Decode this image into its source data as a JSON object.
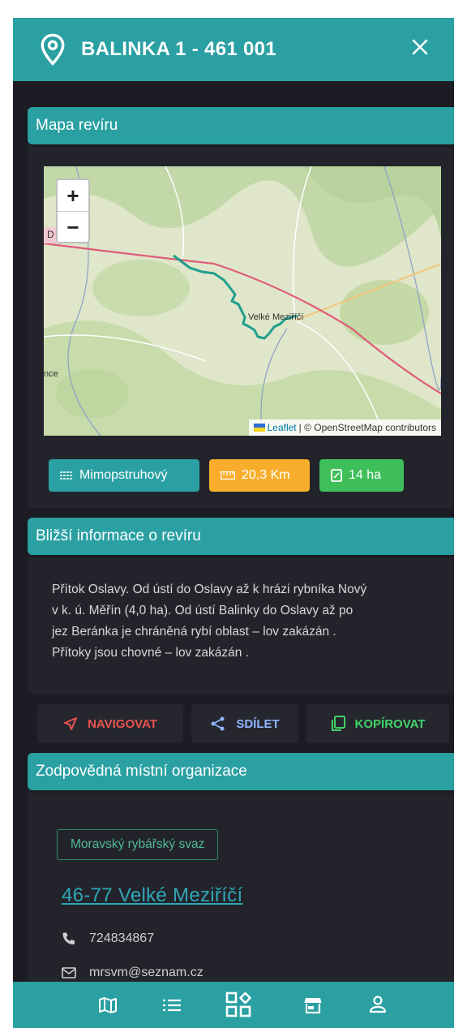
{
  "header": {
    "title": "BALINKA 1 - 461 001"
  },
  "map_card": {
    "title": "Mapa revíru",
    "zoom_in": "+",
    "zoom_out": "−",
    "town_label": "Velké Meziříčí",
    "edge_label_left": "D",
    "edge_label_side": "nce",
    "attribution_link": "Leaflet",
    "attribution_text": "| © OpenStreetMap contributors",
    "chips": [
      {
        "label": "Mimopstruhový",
        "icon": "waves-icon",
        "color": "#2aa0a3"
      },
      {
        "label": "20,3 Km",
        "icon": "ruler-icon",
        "color": "#f8ae2c"
      },
      {
        "label": "14 ha",
        "icon": "area-icon",
        "color": "#3fbf5a"
      }
    ]
  },
  "info_card": {
    "title": "Bližší informace o revíru",
    "lines": [
      "Přítok Oslavy. Od ústí do Oslavy až k hrázi rybníka Nový",
      "v k. ú. Měřín (4,0 ha). Od ústí Balinky do Oslavy až po",
      "jez Beránka je chráněná rybí oblast – lov zakázán .",
      "Přítoky jsou chovné – lov zakázán ."
    ]
  },
  "actions": {
    "navigate": "NAVIGOVAT",
    "share": "SDÍLET",
    "copy": "KOPÍROVAT"
  },
  "org_card": {
    "title": "Zodpovědná místní organizace",
    "badge": "Moravský rybářský svaz",
    "link": "46-77 Velké Meziříčí",
    "phone": "724834867",
    "email": "mrsvm@seznam.cz"
  },
  "colors": {
    "accent": "#2aa0a3",
    "background": "#1c1d24",
    "card": "#23242b",
    "river": "#1f9e8e",
    "road": "#e05b7a"
  },
  "bottom_nav": [
    "map-icon",
    "list-icon",
    "apps-icon",
    "store-icon",
    "user-icon"
  ]
}
